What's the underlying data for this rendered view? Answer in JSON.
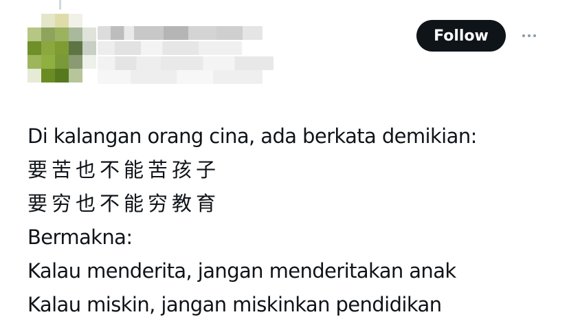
{
  "header": {
    "follow_label": "Follow",
    "more_icon": "more-horizontal-icon"
  },
  "avatar": {
    "blurred": true,
    "colors": [
      [
        "#ffffff",
        "#e3e6c9",
        "#e0dcaa",
        "#f1f1e9",
        "#ffffff"
      ],
      [
        "#b6c683",
        "#8ea35c",
        "#9bb25f",
        "#a9b99b",
        "#dfe3d9"
      ],
      [
        "#6f8f2a",
        "#8aa83d",
        "#7f9c33",
        "#5e7444",
        "#c8cfc4"
      ],
      [
        "#9db55b",
        "#8fb040",
        "#7a9938",
        "#8a9a73",
        "#eef0ea"
      ],
      [
        "#e6ebd8",
        "#6a8c22",
        "#56791d",
        "#b7c59a",
        "#ffffff"
      ]
    ]
  },
  "user": {
    "name_blurred": true
  },
  "tweet": {
    "lines": [
      "Di kalangan orang cina, ada berkata demikian:",
      "要苦也不能苦孩子",
      "要穷也不能穷教育",
      "Bermakna:",
      "Kalau menderita, jangan menderitakan anak",
      "Kalau miskin, jangan miskinkan pendidikan"
    ]
  },
  "colors": {
    "text": "#0f1419",
    "follow_bg": "#0f1419",
    "follow_text": "#ffffff",
    "muted": "#8b98a5"
  }
}
